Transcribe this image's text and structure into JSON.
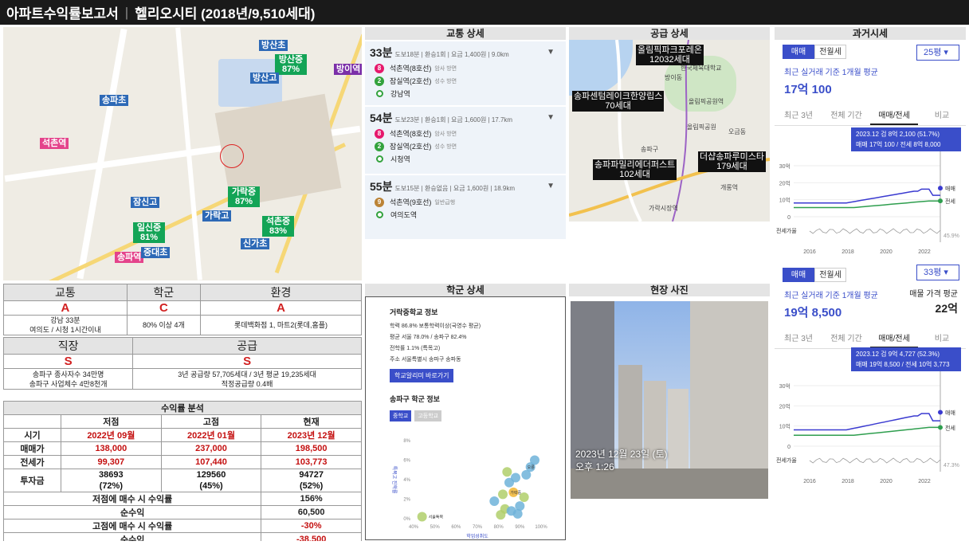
{
  "header": {
    "title": "아파트수익률보고서",
    "apartment": "헬리오시티 (2018년/9,510세대)"
  },
  "map": {
    "labels": [
      {
        "text": "방산초",
        "color": "blue"
      },
      {
        "text": "방산중 87%",
        "color": "green"
      },
      {
        "text": "방산고",
        "color": "blue"
      },
      {
        "text": "방이역",
        "color": "purple"
      },
      {
        "text": "송파초",
        "color": "blue"
      },
      {
        "text": "석촌역",
        "color": "pink"
      },
      {
        "text": "잠신고",
        "color": "blue"
      },
      {
        "text": "가락중 87%",
        "color": "green"
      },
      {
        "text": "가락고",
        "color": "blue"
      },
      {
        "text": "일신중 81%",
        "color": "green"
      },
      {
        "text": "석촌중 83%",
        "color": "green"
      },
      {
        "text": "송파역",
        "color": "pink"
      },
      {
        "text": "중대초",
        "color": "blue"
      },
      {
        "text": "신가초",
        "color": "blue"
      }
    ]
  },
  "transit": {
    "title": "교통 상세",
    "routes": [
      {
        "time": "33분",
        "meta": "도보18분 | 환승1회 | 요금 1,400원 | 9.0km",
        "stops": [
          {
            "line": "8",
            "name": "석촌역(8호선)",
            "dir": "암사 방면"
          },
          {
            "line": "2",
            "name": "잠실역(2호선)",
            "dir": "성수 방면"
          },
          {
            "line": "end",
            "name": "강남역",
            "dir": ""
          }
        ]
      },
      {
        "time": "54분",
        "meta": "도보23분 | 환승1회 | 요금 1,600원 | 17.7km",
        "stops": [
          {
            "line": "8",
            "name": "석촌역(8호선)",
            "dir": "암사 방면"
          },
          {
            "line": "2",
            "name": "잠실역(2호선)",
            "dir": "성수 방면"
          },
          {
            "line": "end",
            "name": "시청역",
            "dir": ""
          }
        ]
      },
      {
        "time": "55분",
        "meta": "도보15분 | 환승없음 | 요금 1,600원 | 18.9km",
        "stops": [
          {
            "line": "9",
            "name": "석촌역(9호선)",
            "dir": "일반급행"
          },
          {
            "line": "end",
            "name": "여의도역",
            "dir": ""
          }
        ]
      }
    ]
  },
  "supply": {
    "title": "공급 상세",
    "labels": [
      "올림픽파크포레온\n12032세대",
      "송파센텀레이크한양립스\n70세대",
      "더샵송파루미스타\n179세대",
      "송파파밀리에더퍼스트\n102세대"
    ],
    "places": [
      "올림픽공원",
      "한국체육대학교",
      "올림픽공원역",
      "송파구",
      "가락시장역",
      "개롱역",
      "방이동",
      "오금동"
    ]
  },
  "price1": {
    "title": "과거시세",
    "tabs": [
      "매매",
      "전월세"
    ],
    "select": "25평 ▾",
    "sub": "최근 실거래 기준 1개월 평균",
    "value": "17억 100",
    "ranges": [
      "최근 3년",
      "전체 기간",
      "매매/전세",
      "비교"
    ],
    "tooltip1": "2023.12  검 8억 2,100 (51.7%)",
    "tooltip2": "매매 17억 100 / 전세 8억 8,000",
    "yticks": [
      "30억",
      "20억",
      "10억",
      "0"
    ],
    "series": [
      "매매",
      "전세"
    ],
    "ratio_label": "전세가율",
    "ratio": "45.9%",
    "xticks": [
      "2016",
      "2018",
      "2020",
      "2022"
    ]
  },
  "price2": {
    "tabs": [
      "매매",
      "전월세"
    ],
    "select": "33평 ▾",
    "sub": "최근 실거래 기준 1개월 평균",
    "value": "19억 8,500",
    "side_label": "매물 가격 평균",
    "side_value": "22억",
    "ranges": [
      "최근 3년",
      "전체 기간",
      "매매/전세",
      "비교"
    ],
    "tooltip1": "2023.12  검 9억 4,727 (52.3%)",
    "tooltip2": "매매 19억 8,500 / 전세 10억 3,773",
    "yticks": [
      "30억",
      "20억",
      "10억",
      "0"
    ],
    "series": [
      "매매",
      "전세"
    ],
    "ratio_label": "전세가율",
    "ratio": "47.3%",
    "xticks": [
      "2016",
      "2018",
      "2020",
      "2022"
    ]
  },
  "summary": {
    "row1_heads": [
      "교통",
      "학군",
      "환경"
    ],
    "row1_grades": [
      "A",
      "C",
      "A"
    ],
    "row1_desc": [
      "강남 33분\n여의도 / 시청 1시간이내",
      "80% 이상 4개",
      "롯데백화점 1, 마트2(롯데,홈플)"
    ],
    "row2_heads": [
      "직장",
      "공급"
    ],
    "row2_grades": [
      "S",
      "S"
    ],
    "row2_desc": [
      "송파구 종사자수 34만명\n송파구 사업체수 4만8천개",
      "3년 공급량 57,705세대 / 3년 평균 19,235세대\n적정공급량 0.4배"
    ]
  },
  "profit": {
    "title": "수익률 분석",
    "cols": [
      "",
      "저점",
      "고점",
      "현재"
    ],
    "rows": [
      {
        "label": "시기",
        "vals": [
          "2022년 09월",
          "2022년 01월",
          "2023년 12월"
        ]
      },
      {
        "label": "매매가",
        "vals": [
          "138,000",
          "237,000",
          "198,500"
        ]
      },
      {
        "label": "전세가",
        "vals": [
          "99,307",
          "107,440",
          "103,773"
        ]
      },
      {
        "label": "투자금",
        "vals": [
          "38693\n(72%)",
          "129560\n(45%)",
          "94727\n(52%)"
        ]
      }
    ],
    "summ": [
      {
        "label": "저점에 매수 시 수익률",
        "val": "156%"
      },
      {
        "label": "순수익",
        "val": "60,500"
      },
      {
        "label": "고점에 매수 시 수익률",
        "val": "-30%"
      },
      {
        "label": "순수익",
        "val": "-38,500"
      }
    ]
  },
  "school": {
    "title": "학군 상세",
    "heading": "거락중학교 정보",
    "lines": [
      "학력 86.8% 보통학력이상(국영수 평균)",
      "평균 서울 78.0% / 송파구 82.4%",
      "전학률 1.1% (특목고)",
      "주소 서울특별시 송파구 송파동"
    ],
    "button": "학교알리미 바로가기",
    "sub_heading": "송파구 학군 정보",
    "chips": [
      "중학교",
      "고등학교"
    ],
    "x_ticks": [
      "40%",
      "50%",
      "60%",
      "70%",
      "80%",
      "90%",
      "100%"
    ],
    "y_ticks": [
      "8%",
      "6%",
      "4%",
      "2%",
      "0%"
    ],
    "x_label": "학업성취도",
    "y_label": "특목고 진학률",
    "points": [
      {
        "name": "서울특목",
        "x": 44,
        "y": 0.2
      },
      {
        "name": "가락중",
        "x": 87,
        "y": 2.7
      },
      {
        "name": "오륜",
        "x": 95,
        "y": 5.3
      },
      {
        "name": "",
        "x": 83,
        "y": 1.0
      },
      {
        "name": "",
        "x": 85,
        "y": 3.7
      },
      {
        "name": "",
        "x": 88,
        "y": 4.2
      },
      {
        "name": "",
        "x": 92,
        "y": 2.2
      },
      {
        "name": "",
        "x": 90,
        "y": 1.3
      },
      {
        "name": "",
        "x": 86,
        "y": 0.8
      },
      {
        "name": "",
        "x": 81,
        "y": 0.4
      },
      {
        "name": "",
        "x": 93,
        "y": 4.5
      },
      {
        "name": "",
        "x": 78,
        "y": 1.8
      },
      {
        "name": "",
        "x": 84,
        "y": 4.8
      },
      {
        "name": "",
        "x": 97,
        "y": 6.0
      },
      {
        "name": "",
        "x": 89,
        "y": 0.5
      },
      {
        "name": "",
        "x": 82,
        "y": 2.5
      }
    ]
  },
  "photo": {
    "title": "현장 사진",
    "caption": "2023년 12월 23일 (토)\n오후 1:26"
  }
}
